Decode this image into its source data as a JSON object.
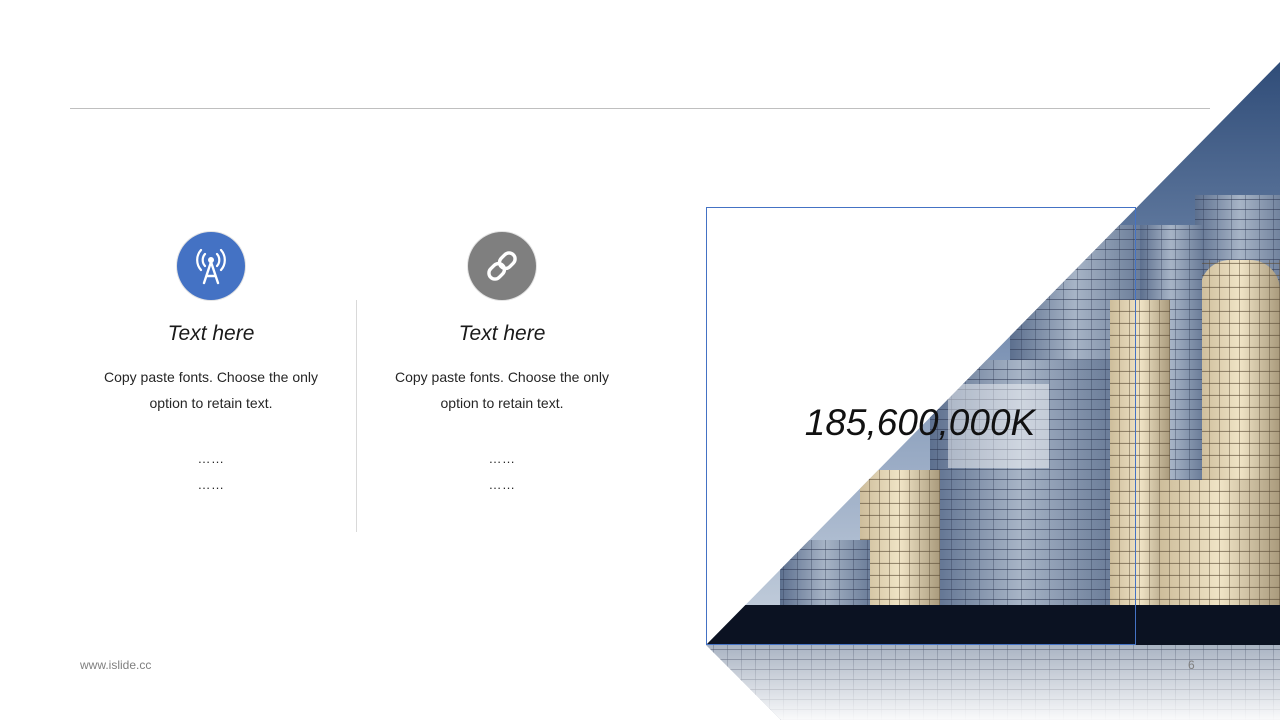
{
  "columns": [
    {
      "icon": "radio-tower-icon",
      "title": "Text here",
      "body_line1": "Copy paste fonts. Choose the only",
      "body_line2": "option to retain text.",
      "dots1": "……",
      "dots2": "……"
    },
    {
      "icon": "link-icon",
      "title": "Text here",
      "body_line1": "Copy paste fonts. Choose the only",
      "body_line2": "option to retain text.",
      "dots1": "……",
      "dots2": "……"
    }
  ],
  "stat": "185,600,000K",
  "footer": {
    "website": "www.islide.cc",
    "page_number": "6"
  },
  "colors": {
    "accent": "#4472c4",
    "icon_gray": "#7f7f7f",
    "rule": "#bfbfbf"
  }
}
